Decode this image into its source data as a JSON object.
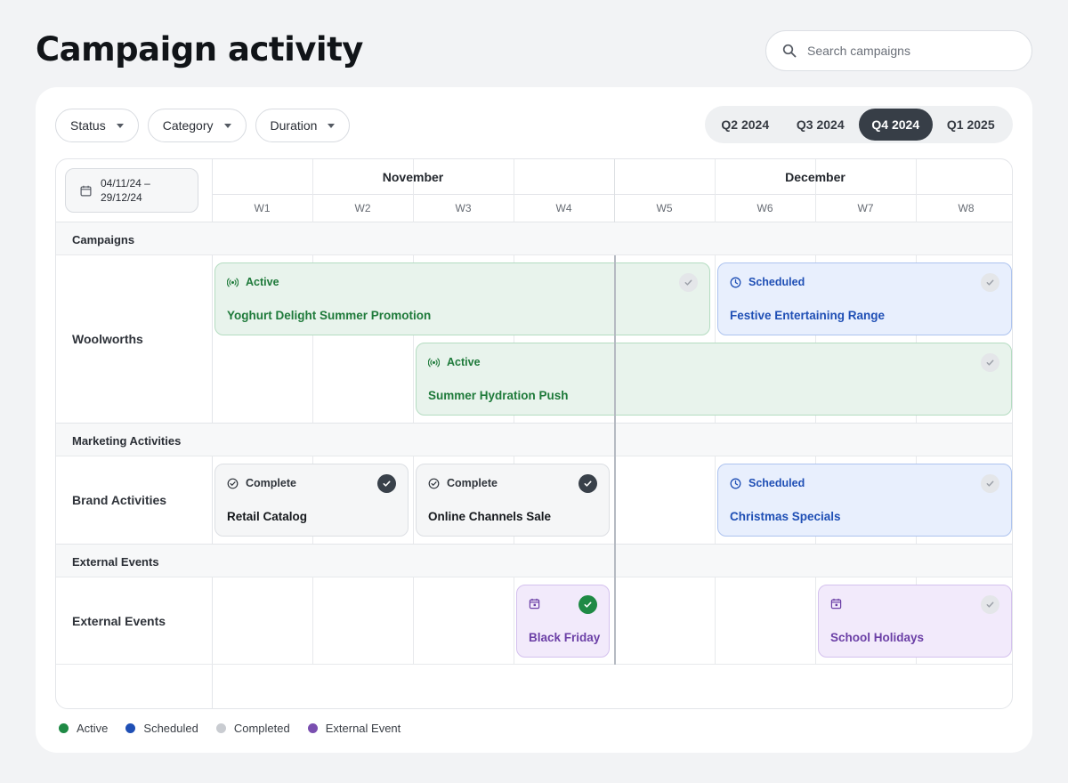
{
  "header": {
    "title": "Campaign activity",
    "search_placeholder": "Search campaigns"
  },
  "filters": [
    {
      "label": "Status"
    },
    {
      "label": "Category"
    },
    {
      "label": "Duration"
    }
  ],
  "quarters": [
    {
      "label": "Q2 2024",
      "active": false
    },
    {
      "label": "Q3 2024",
      "active": false
    },
    {
      "label": "Q4 2024",
      "active": true
    },
    {
      "label": "Q1 2025",
      "active": false
    }
  ],
  "timeline": {
    "date_range": "04/11/24 – 29/12/24",
    "months": [
      "November",
      "December"
    ],
    "weeks": [
      "W1",
      "W2",
      "W3",
      "W4",
      "W5",
      "W6",
      "W7",
      "W8"
    ]
  },
  "sections": [
    {
      "title": "Campaigns",
      "rows": [
        {
          "label": "Woolworths"
        }
      ]
    },
    {
      "title": "Marketing Activities",
      "rows": [
        {
          "label": "Brand Activities"
        }
      ]
    },
    {
      "title": "External Events",
      "rows": [
        {
          "label": "External Events"
        }
      ]
    }
  ],
  "events": [
    {
      "name": "Yoghurt Delight Summer Promotion",
      "status": "Active",
      "kind": "active",
      "done": false
    },
    {
      "name": "Festive Entertaining Range",
      "status": "Scheduled",
      "kind": "scheduled",
      "done": false
    },
    {
      "name": "Summer Hydration Push",
      "status": "Active",
      "kind": "active",
      "done": false
    },
    {
      "name": "Retail Catalog",
      "status": "Complete",
      "kind": "complete",
      "done": true
    },
    {
      "name": "Online Channels Sale",
      "status": "Complete",
      "kind": "complete",
      "done": true
    },
    {
      "name": "Christmas Specials",
      "status": "Scheduled",
      "kind": "scheduled",
      "done": false
    },
    {
      "name": "Black Friday",
      "status": "",
      "kind": "external",
      "done": true
    },
    {
      "name": "School Holidays",
      "status": "",
      "kind": "external",
      "done": false
    }
  ],
  "legend": [
    {
      "label": "Active",
      "color": "#1f8a45"
    },
    {
      "label": "Scheduled",
      "color": "#1f4fb5"
    },
    {
      "label": "Completed",
      "color": "#c9ccd1"
    },
    {
      "label": "External Event",
      "color": "#7a4fb0"
    }
  ],
  "colors": {
    "accent_dark": "#373e47",
    "active": "#1f8a45",
    "scheduled": "#1f4fb5",
    "external": "#6b3fa6"
  }
}
